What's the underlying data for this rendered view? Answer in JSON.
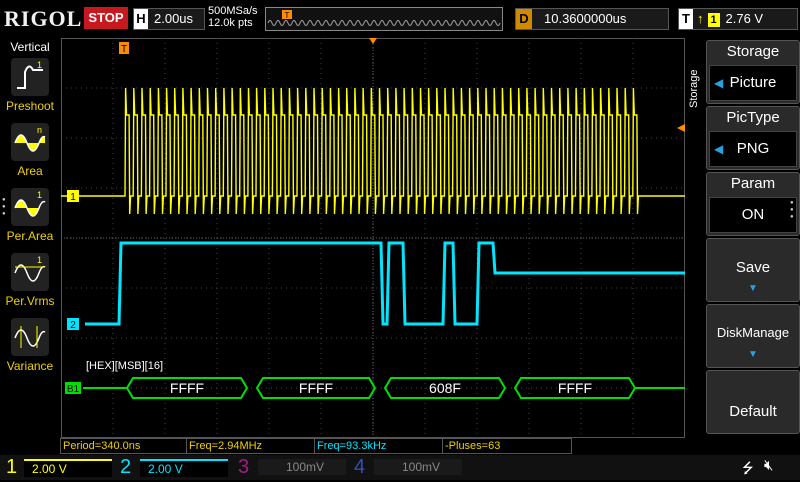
{
  "header": {
    "brand": "RIGOL",
    "run_state": "STOP",
    "timebase_key": "H",
    "timebase": "2.00us",
    "sample_rate": "500MSa/s",
    "memory_depth": "12.0k pts",
    "delay_key": "D",
    "delay": "10.3600000us",
    "trigger_key": "T",
    "trigger_source": "1",
    "trigger_level": "2.76 V"
  },
  "left_menu": {
    "title": "Vertical",
    "items": [
      {
        "label": "Preshoot",
        "icon": "preshoot-icon"
      },
      {
        "label": "Area",
        "icon": "area-icon"
      },
      {
        "label": "Per.Area",
        "icon": "per-area-icon"
      },
      {
        "label": "Per.Vrms",
        "icon": "per-vrms-icon"
      },
      {
        "label": "Variance",
        "icon": "variance-icon"
      }
    ]
  },
  "right_menu": {
    "side_label": "Storage",
    "title": "Storage",
    "items": [
      {
        "label": "Storage",
        "value": "Picture"
      },
      {
        "label": "PicType",
        "value": "PNG"
      },
      {
        "label": "Param",
        "value": "ON"
      },
      {
        "label": "Save"
      },
      {
        "label": "DiskManage"
      },
      {
        "label": "Default"
      }
    ]
  },
  "waveform": {
    "ch1_marker": "1",
    "ch2_marker": "2",
    "bus_marker": "B1",
    "trigger_marker": "T",
    "decode_label": "[HEX][MSB][16]",
    "decode_values": [
      "FFFF",
      "FFFF",
      "608F",
      "FFFF"
    ],
    "colors": {
      "ch1": "#ffff00",
      "ch2": "#00e5ff",
      "bus": "#00e000",
      "trigger": "#ff8c00"
    }
  },
  "measurements": {
    "period": "Period=340.0ns",
    "freq1": "Freq=2.94MHz",
    "freq2": "Freq=93.3kHz",
    "pulses": "-Pluses=63"
  },
  "channels": [
    {
      "num": "1",
      "scale": "2.00 V",
      "color": "#ffff00"
    },
    {
      "num": "2",
      "scale": "2.00 V",
      "color": "#00e5ff"
    },
    {
      "num": "3",
      "scale": "100mV",
      "color": "#a01f80"
    },
    {
      "num": "4",
      "scale": "100mV",
      "color": "#3050c0"
    }
  ]
}
